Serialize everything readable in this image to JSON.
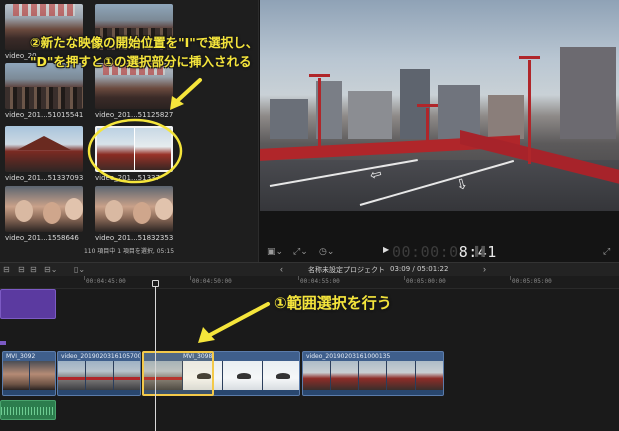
{
  "browser": {
    "clips": [
      {
        "label": "video_20..."
      },
      {
        "label": ""
      },
      {
        "label": "video_201...51015541"
      },
      {
        "label": "video_201...51125827"
      },
      {
        "label": "video_201...51337093"
      },
      {
        "label": "video_201...51337"
      },
      {
        "label": "video_201...1558646"
      },
      {
        "label": "video_201...51832353"
      }
    ],
    "status": "110 項目中 1 項目を選択, 05:15"
  },
  "viewer": {
    "timecode_dim": "00:00:0",
    "timecode_bright": "8:41"
  },
  "timeline": {
    "project_name": "名称未設定プロジェクト",
    "project_time": "03:09 / 05:01:22",
    "ruler": [
      "00:04:45:00",
      "00:04:50:00",
      "00:04:55:00",
      "00:05:00:00",
      "00:05:05:00"
    ],
    "clips": [
      {
        "label": "MVI_3092"
      },
      {
        "label": "video_20190203161057000"
      },
      {
        "label": "MVI_3098"
      },
      {
        "label": "video_20190203161000135"
      }
    ]
  },
  "annotations": {
    "line1": "②新たな映像の開始位置を\"I\"で選択し、",
    "line2": "\"D\"を押すと①の選択部分に挿入される",
    "range": "①範囲選択を行う"
  },
  "colors": {
    "annotation": "#f5e53b",
    "clip_blue": "#3f5f8c",
    "clip_purple": "#5b3aa0",
    "audio_green": "#2c7d4d",
    "selection": "#f3c94a"
  }
}
